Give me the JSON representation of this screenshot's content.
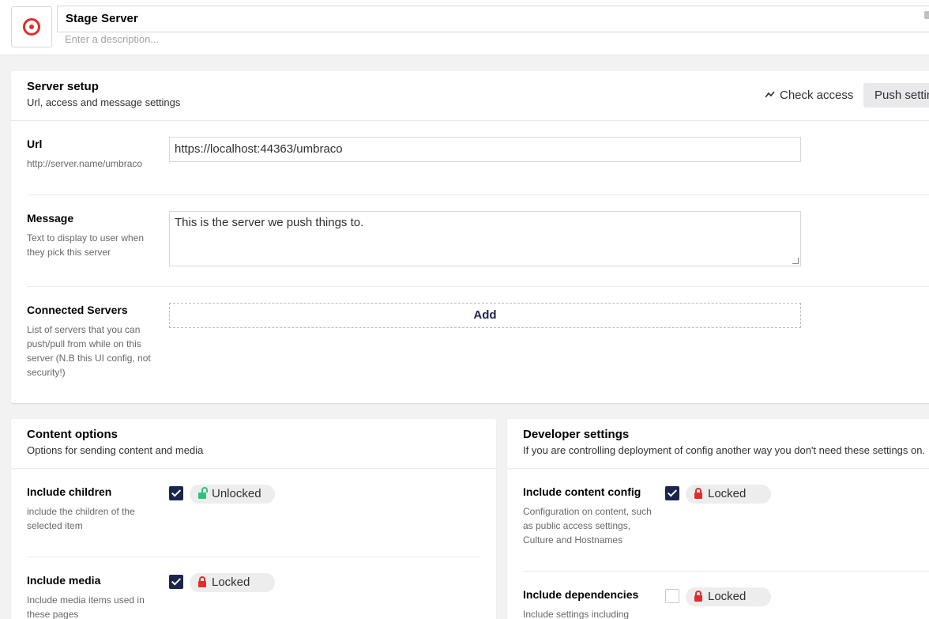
{
  "header": {
    "name": "Stage Server",
    "description_placeholder": "Enter a description..."
  },
  "setup": {
    "title": "Server setup",
    "subtitle": "Url, access and message settings",
    "check_access": "Check access",
    "push_settings": "Push settings",
    "url": {
      "label": "Url",
      "desc": "http://server.name/umbraco",
      "value": "https://localhost:44363/umbraco"
    },
    "message": {
      "label": "Message",
      "desc": "Text to display to user when they pick this server",
      "value": "This is the server we push things to."
    },
    "connected": {
      "label": "Connected Servers",
      "desc": "List of servers that you can push/pull from while on this server (N.B this UI config, not security!)",
      "add": "Add"
    }
  },
  "content": {
    "title": "Content options",
    "subtitle": "Options for sending content and media",
    "children": {
      "label": "Include children",
      "desc": "include the children of the selected item",
      "checked": true,
      "lock": "Unlocked"
    },
    "media": {
      "label": "Include media",
      "desc": "Include media items used in these pages",
      "checked": true,
      "lock": "Locked"
    }
  },
  "developer": {
    "title": "Developer settings",
    "subtitle": "If you are controlling deployment of config another way you don't need these settings on.",
    "content_config": {
      "label": "Include content config",
      "desc": "Configuration on content, such as public access settings, Culture and Hostnames",
      "checked": true,
      "lock": "Locked"
    },
    "dependencies": {
      "label": "Include dependencies",
      "desc": "Include settings including",
      "checked": false,
      "lock": "Locked"
    }
  },
  "colors": {
    "accent": "#1b264f",
    "lock_red": "#e22c2c",
    "unlock_green": "#2bc37c"
  }
}
